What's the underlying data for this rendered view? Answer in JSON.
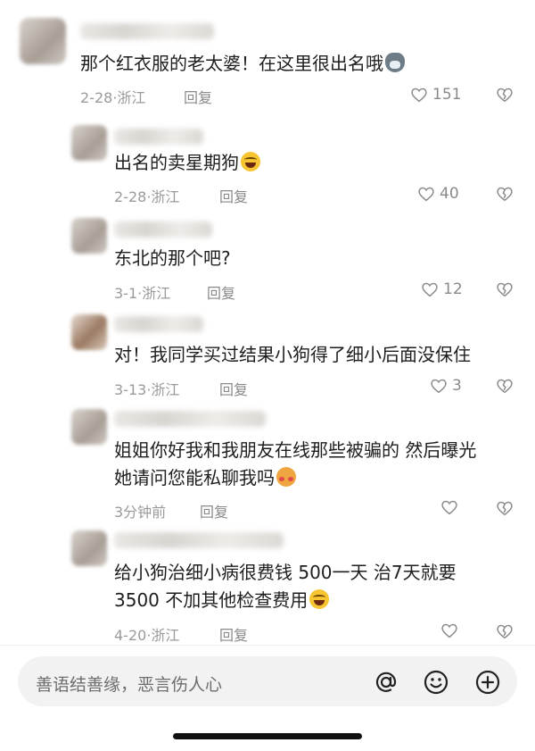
{
  "comments": [
    {
      "text": "那个红衣服的老太婆！在这里很出名哦",
      "emoji": "wolf-emoji",
      "date": "2-28·浙江",
      "reply": "回复",
      "likes": "151"
    },
    {
      "text": "出名的卖星期狗",
      "emoji": "laugh-emoji",
      "date": "2-28·浙江",
      "reply": "回复",
      "likes": "40"
    },
    {
      "text": "东北的那个吧?",
      "date": "3-1·浙江",
      "reply": "回复",
      "likes": "12"
    },
    {
      "text": "对！我同学买过结果小狗得了细小后面没保住",
      "date": "3-13·浙江",
      "reply": "回复",
      "likes": "3"
    },
    {
      "text": "姐姐你好我和我朋友在线那些被骗的 然后曝光",
      "text2": "她请问您能私聊我吗",
      "emoji": "shy-emoji",
      "date": "3分钟前",
      "reply": "回复",
      "likes": ""
    },
    {
      "text": "给小狗治细小病很费钱 500一天 治7天就要",
      "text2": "3500 不加其他检查费用",
      "emoji": "laugh-emoji",
      "date": "4-20·浙江",
      "reply": "回复",
      "likes": ""
    }
  ],
  "input": {
    "placeholder": "善语结善缘，恶言伤人心",
    "icons": [
      "at-icon",
      "emoji-icon",
      "plus-icon"
    ]
  }
}
